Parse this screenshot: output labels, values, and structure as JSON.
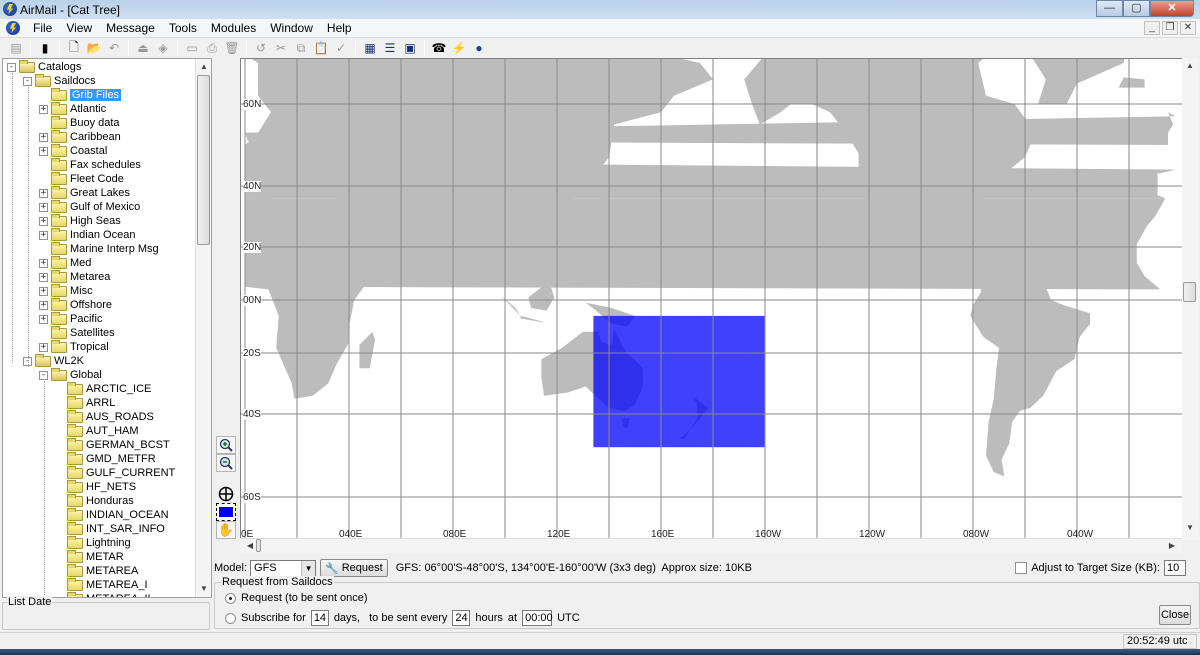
{
  "window": {
    "title": "AirMail - [Cat Tree]",
    "minimize": "—",
    "maximize": "▢",
    "close": "✕"
  },
  "menu": {
    "items": [
      "File",
      "View",
      "Message",
      "Tools",
      "Modules",
      "Window",
      "Help"
    ]
  },
  "mdi": {
    "minimize": "_",
    "restore": "❐",
    "close": "✕"
  },
  "toolbar": {
    "buttons": [
      {
        "icon": "list-view-icon",
        "glyph": "▤",
        "enabled": false
      },
      {
        "icon": "book-icon",
        "glyph": "▮",
        "enabled": true
      },
      {
        "icon": "new-message-icon",
        "glyph": "🗋",
        "enabled": true
      },
      {
        "icon": "open-folder-icon",
        "glyph": "📂",
        "enabled": false
      },
      {
        "icon": "reply-icon",
        "glyph": "↶",
        "enabled": false
      },
      {
        "icon": "stamp-icon",
        "glyph": "⏏",
        "enabled": false
      },
      {
        "icon": "attach-icon",
        "glyph": "◈",
        "enabled": false
      },
      {
        "icon": "file-cabinet-icon",
        "glyph": "▭",
        "enabled": false
      },
      {
        "icon": "print-icon",
        "glyph": "⎙",
        "enabled": false
      },
      {
        "icon": "delete-icon",
        "glyph": "🗑",
        "enabled": false
      },
      {
        "icon": "undo-icon",
        "glyph": "↺",
        "enabled": false
      },
      {
        "icon": "cut-icon",
        "glyph": "✂",
        "enabled": false
      },
      {
        "icon": "copy-icon",
        "glyph": "⧉",
        "enabled": false
      },
      {
        "icon": "paste-icon",
        "glyph": "📋",
        "enabled": false
      },
      {
        "icon": "spellcheck-icon",
        "glyph": "✓",
        "enabled": false
      },
      {
        "icon": "catalog-icon",
        "glyph": "▦",
        "enabled": true
      },
      {
        "icon": "list-icon",
        "glyph": "☰",
        "enabled": true
      },
      {
        "icon": "window-icon",
        "glyph": "▣",
        "enabled": true
      },
      {
        "icon": "modem-icon",
        "glyph": "☎",
        "enabled": true
      },
      {
        "icon": "lightning-icon",
        "glyph": "⚡",
        "enabled": true
      },
      {
        "icon": "airmail-globe-icon",
        "glyph": "●",
        "enabled": true
      }
    ]
  },
  "tree": {
    "selected": "Grib Files",
    "nodes": [
      {
        "label": "Catalogs",
        "level": 0,
        "expander": "−",
        "open": true
      },
      {
        "label": "Saildocs",
        "level": 1,
        "expander": "−",
        "open": true
      },
      {
        "label": "Grib Files",
        "level": 2,
        "expander": null,
        "selected": true
      },
      {
        "label": "Atlantic",
        "level": 2,
        "expander": "+"
      },
      {
        "label": "Buoy data",
        "level": 2,
        "expander": null
      },
      {
        "label": "Caribbean",
        "level": 2,
        "expander": "+"
      },
      {
        "label": "Coastal",
        "level": 2,
        "expander": "+"
      },
      {
        "label": "Fax schedules",
        "level": 2,
        "expander": null
      },
      {
        "label": "Fleet Code",
        "level": 2,
        "expander": null
      },
      {
        "label": "Great Lakes",
        "level": 2,
        "expander": "+"
      },
      {
        "label": "Gulf of Mexico",
        "level": 2,
        "expander": "+"
      },
      {
        "label": "High Seas",
        "level": 2,
        "expander": "+"
      },
      {
        "label": "Indian Ocean",
        "level": 2,
        "expander": "+"
      },
      {
        "label": "Marine Interp Msg",
        "level": 2,
        "expander": null
      },
      {
        "label": "Med",
        "level": 2,
        "expander": "+"
      },
      {
        "label": "Metarea",
        "level": 2,
        "expander": "+"
      },
      {
        "label": "Misc",
        "level": 2,
        "expander": "+"
      },
      {
        "label": "Offshore",
        "level": 2,
        "expander": "+"
      },
      {
        "label": "Pacific",
        "level": 2,
        "expander": "+"
      },
      {
        "label": "Satellites",
        "level": 2,
        "expander": null
      },
      {
        "label": "Tropical",
        "level": 2,
        "expander": "+"
      },
      {
        "label": "WL2K",
        "level": 1,
        "expander": "−",
        "open": true
      },
      {
        "label": "Global",
        "level": 2,
        "expander": "−",
        "open": true
      },
      {
        "label": "ARCTIC_ICE",
        "level": 3,
        "expander": null
      },
      {
        "label": "ARRL",
        "level": 3,
        "expander": null
      },
      {
        "label": "AUS_ROADS",
        "level": 3,
        "expander": null
      },
      {
        "label": "AUT_HAM",
        "level": 3,
        "expander": null
      },
      {
        "label": "GERMAN_BCST",
        "level": 3,
        "expander": null
      },
      {
        "label": "GMD_METFR",
        "level": 3,
        "expander": null
      },
      {
        "label": "GULF_CURRENT",
        "level": 3,
        "expander": null
      },
      {
        "label": "HF_NETS",
        "level": 3,
        "expander": null
      },
      {
        "label": "Honduras",
        "level": 3,
        "expander": null
      },
      {
        "label": "INDIAN_OCEAN",
        "level": 3,
        "expander": null
      },
      {
        "label": "INT_SAR_INFO",
        "level": 3,
        "expander": null
      },
      {
        "label": "Lightning",
        "level": 3,
        "expander": null
      },
      {
        "label": "METAR",
        "level": 3,
        "expander": null
      },
      {
        "label": "METAREA",
        "level": 3,
        "expander": null
      },
      {
        "label": "METAREA_I",
        "level": 3,
        "expander": null
      },
      {
        "label": "METAREA_II",
        "level": 3,
        "expander": null
      }
    ]
  },
  "list_date": {
    "label": "List Date"
  },
  "map": {
    "lat_labels": [
      "60N",
      "40N",
      "20N",
      "00N",
      "20S",
      "40S",
      "60S"
    ],
    "lon_labels": [
      "0E",
      "040E",
      "080E",
      "120E",
      "160E",
      "160W",
      "120W",
      "080W",
      "040W"
    ],
    "selection": {
      "north": "06°00'S",
      "south": "48°00'S",
      "west": "134°00'E",
      "east": "160°00'W",
      "color": "#0000ff"
    },
    "land_color": "#bcbcbc",
    "grid_color": "#8a8a8a",
    "tools": [
      {
        "name": "zoom-in-icon",
        "glyph": "⊕"
      },
      {
        "name": "zoom-out-icon",
        "glyph": "⊖"
      },
      {
        "name": "center-crosshair-icon",
        "glyph": "⊕"
      },
      {
        "name": "select-area-icon",
        "glyph": ""
      },
      {
        "name": "pan-hand-icon",
        "glyph": "✋"
      }
    ]
  },
  "request": {
    "model_label": "Model:",
    "model_value": "GFS",
    "request_button": "Request",
    "info": "GFS: 06°00'S-48°00'S, 134°00'E-160°00'W (3x3 deg)  Approx size: 10KB",
    "adjust_label": "Adjust to Target Size (KB):",
    "adjust_checked": false,
    "target_size": "10",
    "group_title": "Request from Saildocs",
    "option_once": "Request (to be sent once)",
    "option_subscribe": "Subscribe for",
    "subscribe_days": "14",
    "days_label": "days,",
    "every_label": "to be sent every",
    "every_hours": "24",
    "hours_label": "hours",
    "at_label": "at",
    "at_time": "00:00",
    "utc_label": "UTC",
    "selected_option": "once",
    "close_button": "Close"
  },
  "status": {
    "time": "20:52:49 utc"
  }
}
